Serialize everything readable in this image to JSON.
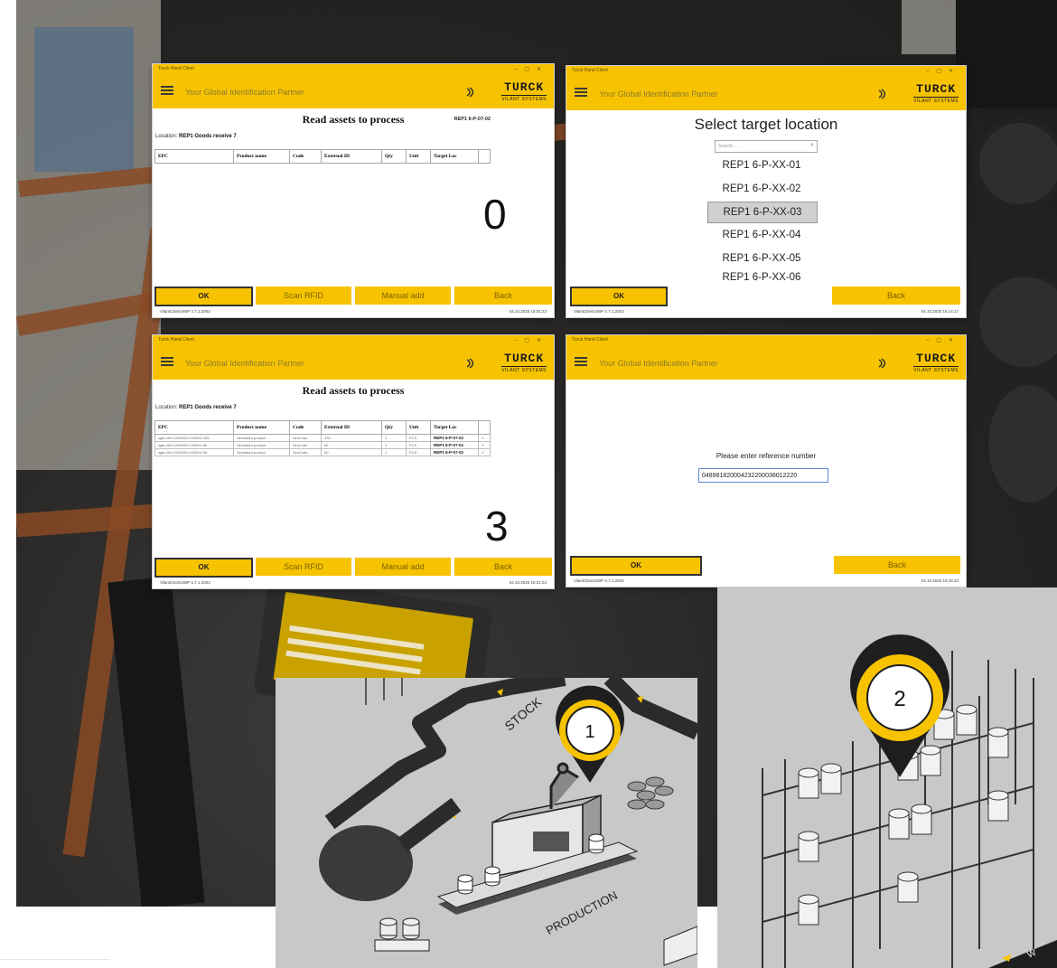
{
  "window_title": "Turck Hand Client",
  "tagline": "Your Global Identification Partner",
  "logo": {
    "brand": "TURCK",
    "sub": "VILANT SYSTEMS"
  },
  "status_version": "VilantClientUWP 4.7.1.2003",
  "buttons": {
    "ok": "OK",
    "scan": "Scan RFID",
    "manual": "Manual add",
    "back": "Back"
  },
  "columns": [
    "EPC",
    "Product name",
    "Code",
    "External ID",
    "Qty",
    "Unit",
    "Target Loc"
  ],
  "win1": {
    "title": "Read assets to process",
    "ref": "REP1 6-P-07-02",
    "location_label": "Location:",
    "location_value": "REP1 Goods receive 7",
    "count": "0",
    "timestamp": "04.10.2020 18:01:23"
  },
  "win2": {
    "title": "Select target location",
    "search_placeholder": "Search...",
    "items": [
      "REP1 6-P-XX-01",
      "REP1 6-P-XX-02",
      "REP1 6-P-XX-03",
      "REP1 6-P-XX-04",
      "REP1 6-P-XX-05",
      "REP1 6-P-XX-06"
    ],
    "selected_index": 2,
    "timestamp": "04.10.2020 18:14:17"
  },
  "win3": {
    "title": "Read assets to process",
    "location_label": "Location:",
    "location_value": "REP1 Goods receive 7",
    "rows": [
      {
        "epc": "sgtin-96:0.0000001.000001.335",
        "product": "Simulated product",
        "code": "SimCode",
        "ext": "335",
        "qty": "1",
        "unit": "PCS",
        "target": "REP1 6-P-07-02",
        "x": "X"
      },
      {
        "epc": "sgtin-96:0.0000001.000001.86",
        "product": "Simulated product",
        "code": "SimCode",
        "ext": "86",
        "qty": "1",
        "unit": "PCS",
        "target": "REP1 6-P-07-02",
        "x": "X"
      },
      {
        "epc": "sgtin-96:0.0000001.000001.50",
        "product": "Simulated product",
        "code": "SimCode",
        "ext": "50",
        "qty": "1",
        "unit": "PCS",
        "target": "REP1 6-P-07-02",
        "x": "X"
      }
    ],
    "count": "3",
    "timestamp": "04.10.2020 18:01:23"
  },
  "win4": {
    "prompt": "Please enter reference number",
    "reference": "048981820004232200038012220",
    "timestamp": "04.10.2020 18:15:23"
  },
  "illus1": {
    "pin": "1",
    "stock_label": "STOCK",
    "production_label": "PRODUCTION"
  },
  "illus2": {
    "pin": "2",
    "partial_label": "W"
  },
  "colors": {
    "accent": "#f7c300",
    "dark": "#222222",
    "illustration_bg": "#c8c8c8"
  }
}
